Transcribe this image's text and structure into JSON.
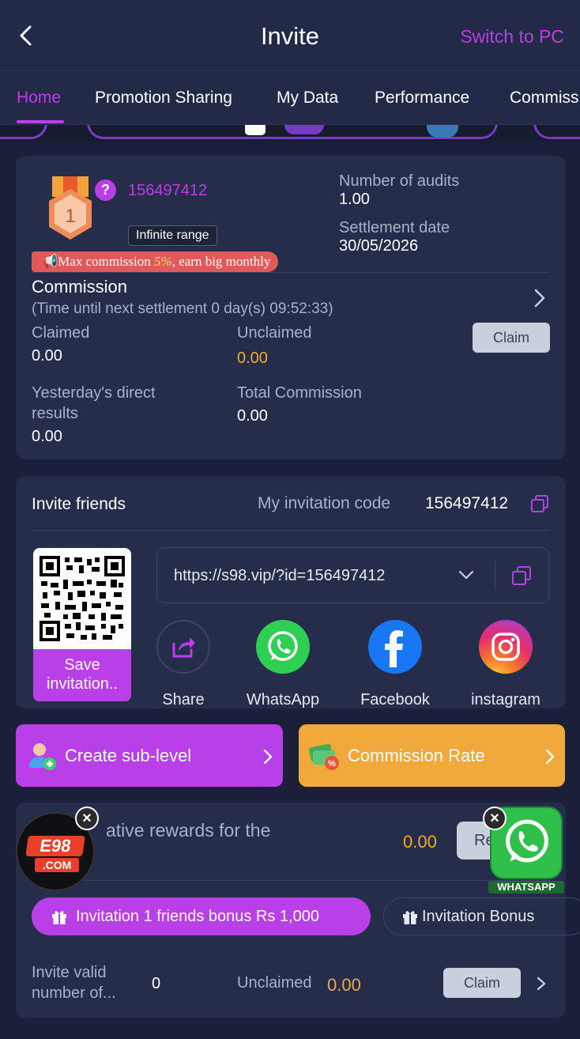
{
  "header": {
    "title": "Invite",
    "switch_pc": "Switch to PC"
  },
  "tabs": [
    {
      "label": "Home"
    },
    {
      "label": "Promotion Sharing"
    },
    {
      "label": "My Data"
    },
    {
      "label": "Performance"
    },
    {
      "label": "Commiss"
    }
  ],
  "profile": {
    "rank": "1",
    "user_id": "156497412",
    "tooltip": "Infinite range",
    "promo_prefix": "Max commission ",
    "promo_rate": "5%",
    "promo_suffix": ", earn big monthly",
    "audits_label": "Number of audits",
    "audits_value": "1.00",
    "settlement_label": "Settlement date",
    "settlement_value": "30/05/2026"
  },
  "commission": {
    "title": "Commission",
    "countdown": "(Time until next settlement  0 day(s) 09:52:33)",
    "claimed_label": "Claimed",
    "claimed_value": "0.00",
    "unclaimed_label": "Unclaimed",
    "unclaimed_value": "0.00",
    "claim_button": "Claim",
    "yesterday_label_1": "Yesterday's direct",
    "yesterday_label_2": "results",
    "yesterday_value": "0.00",
    "total_label": "Total Commission",
    "total_value": "0.00"
  },
  "invite": {
    "title": "Invite friends",
    "code_label": "My invitation code",
    "code_value": "156497412",
    "save_line_1": "Save",
    "save_line_2": "invitation..",
    "link": "https://s98.vip/?id=156497412",
    "socials": [
      {
        "name": "Share"
      },
      {
        "name": "WhatsApp"
      },
      {
        "name": "Facebook"
      },
      {
        "name": "instagram"
      }
    ]
  },
  "actions": {
    "create_sublevel": "Create sub-level",
    "commission_rate": "Commission Rate"
  },
  "rewards": {
    "title_partial": "ative rewards for the",
    "amount": "0.00",
    "button_partial": "Re",
    "chip_active": "Invitation 1 friends bonus Rs 1,000",
    "chip_inactive": "Invitation Bonus",
    "valid_label_1": "Invite valid",
    "valid_label_2": "number of...",
    "valid_value": "0",
    "unclaimed_label": "Unclaimed",
    "unclaimed_value": "0.00",
    "claim_button": "Claim"
  },
  "floating": {
    "e98_main": "E98",
    "e98_sub": ".COM",
    "whatsapp_badge": "WHATSAPP"
  },
  "colors": {
    "accent": "#b93fe8",
    "orange": "#f2a93b",
    "background": "#1a2038",
    "card": "#252d4a"
  }
}
